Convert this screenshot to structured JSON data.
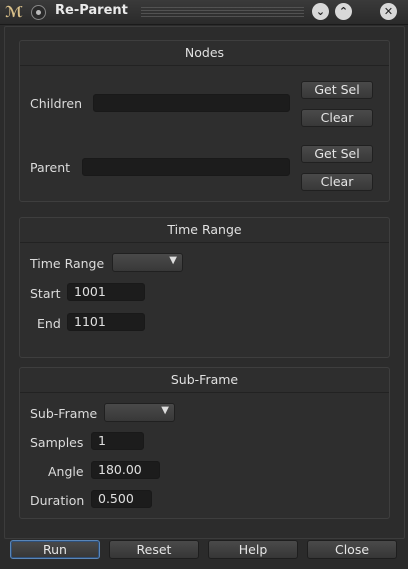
{
  "window": {
    "title": "Re-Parent"
  },
  "nodes": {
    "title": "Nodes",
    "children_label": "Children",
    "children_value": "",
    "parent_label": "Parent",
    "parent_value": "",
    "get_sel_label": "Get Sel",
    "clear_label": "Clear"
  },
  "time_range": {
    "title": "Time Range",
    "range_label": "Time Range",
    "range_value": "",
    "start_label": "Start",
    "start_value": "1001",
    "end_label": "End",
    "end_value": "1101"
  },
  "sub_frame": {
    "title": "Sub-Frame",
    "subframe_label": "Sub-Frame",
    "subframe_value": "",
    "samples_label": "Samples",
    "samples_value": "1",
    "angle_label": "Angle",
    "angle_value": "180.00",
    "duration_label": "Duration",
    "duration_value": "0.500"
  },
  "actions": {
    "run": "Run",
    "reset": "Reset",
    "help": "Help",
    "close": "Close"
  }
}
